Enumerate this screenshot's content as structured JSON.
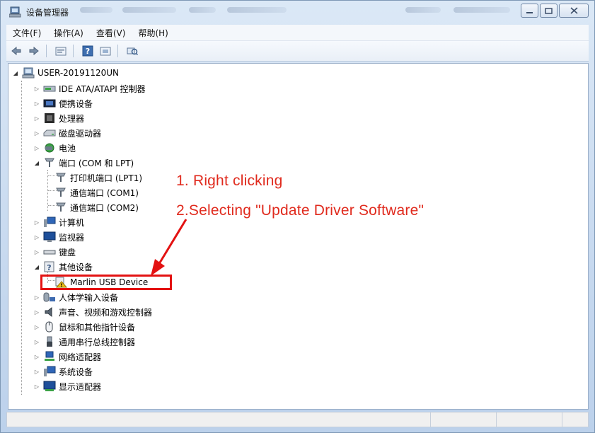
{
  "window": {
    "title": "设备管理器"
  },
  "menubar": {
    "items": [
      "文件(F)",
      "操作(A)",
      "查看(V)",
      "帮助(H)"
    ]
  },
  "toolbar": {
    "buttons": [
      "back-icon",
      "forward-icon",
      "properties-icon",
      "help-icon",
      "show-hidden-icon",
      "scan-hardware-icon"
    ]
  },
  "tree": {
    "root": "USER-20191120UN",
    "nodes": {
      "ide": "IDE ATA/ATAPI 控制器",
      "portable": "便携设备",
      "cpu": "处理器",
      "disk": "磁盘驱动器",
      "battery": "电池",
      "ports": "端口 (COM 和 LPT)",
      "lpt1": "打印机端口 (LPT1)",
      "com1": "通信端口 (COM1)",
      "com2": "通信端口 (COM2)",
      "computer": "计算机",
      "monitor": "监视器",
      "keyboard": "键盘",
      "other": "其他设备",
      "marlin": "Marlin USB Device",
      "hid": "人体学输入设备",
      "sound": "声音、视频和游戏控制器",
      "mouse": "鼠标和其他指针设备",
      "usb": "通用串行总线控制器",
      "network": "网络适配器",
      "system": "系统设备",
      "display": "显示适配器"
    }
  },
  "annotations": {
    "step1": "1. Right clicking",
    "step2": "2.Selecting \"Update Driver Software\""
  },
  "colors": {
    "annotation": "#e02a1d",
    "highlight": "#e31212"
  }
}
